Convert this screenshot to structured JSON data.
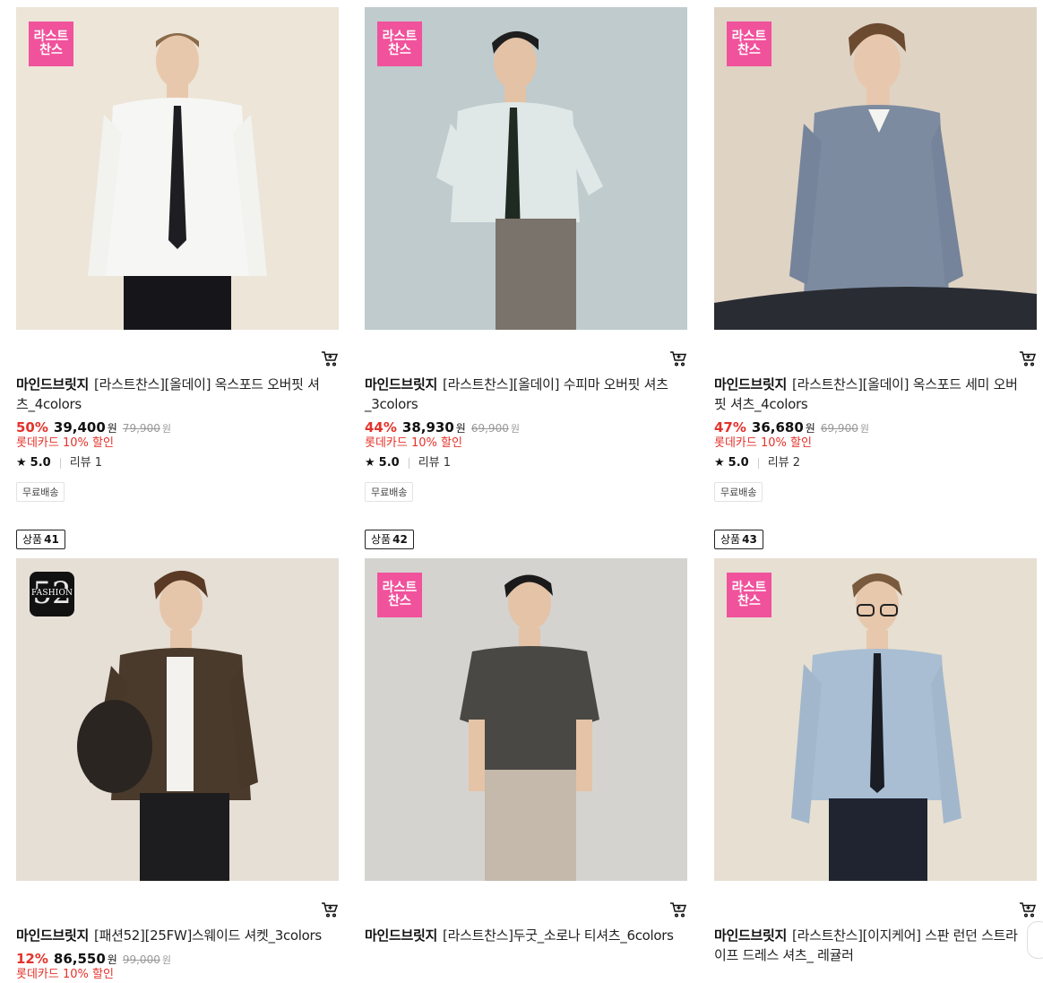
{
  "products": [
    {
      "badge": "last_chance",
      "brand": "마인드브릿지",
      "name": "[라스트찬스][올데이] 옥스포드 오버핏 셔츠_4colors",
      "discount_rate": "50%",
      "price": "39,400",
      "original_price": "79,900",
      "currency": "원",
      "card_discount": "롯데카드 10% 할인",
      "rating": "5.0",
      "review": "리뷰 1",
      "shipping": "무료배송",
      "bg_color": "#ece5d8"
    },
    {
      "badge": "last_chance",
      "brand": "마인드브릿지",
      "name": "[라스트찬스][올데이] 수피마 오버핏 셔츠_3colors",
      "discount_rate": "44%",
      "price": "38,930",
      "original_price": "69,900",
      "currency": "원",
      "card_discount": "롯데카드 10% 할인",
      "rating": "5.0",
      "review": "리뷰 1",
      "shipping": "무료배송",
      "bg_color": "#bfcbcd"
    },
    {
      "badge": "last_chance",
      "brand": "마인드브릿지",
      "name": "[라스트찬스][올데이] 옥스포드 세미 오버핏 셔츠_4colors",
      "discount_rate": "47%",
      "price": "36,680",
      "original_price": "69,900",
      "currency": "원",
      "card_discount": "롯데카드 10% 할인",
      "rating": "5.0",
      "review": "리뷰 2",
      "shipping": "무료배송",
      "bg_color": "#dfd3c4"
    },
    {
      "badge": "fashion52",
      "label": "상품",
      "label_num": "41",
      "brand": "마인드브릿지",
      "name": "[패션52][25FW]스웨이드 셔켓_3colors",
      "discount_rate": "12%",
      "price": "86,550",
      "original_price": "99,000",
      "currency": "원",
      "card_discount": "롯데카드 10% 할인",
      "bg_color": "#e6dfd6"
    },
    {
      "badge": "last_chance",
      "label": "상품",
      "label_num": "42",
      "brand": "마인드브릿지",
      "name": "[라스트찬스]두굿_소로나 티셔츠_6colors",
      "bg_color": "#d5d3d0"
    },
    {
      "badge": "last_chance",
      "label": "상품",
      "label_num": "43",
      "brand": "마인드브릿지",
      "name": "[라스트찬스][이지케어] 스판 런던 스트라이프 드레스 셔츠_ 레귤러",
      "bg_color": "#e6dfd2"
    }
  ],
  "last_chance_badge": {
    "line1": "라스트",
    "line2": "찬스"
  },
  "fashion_badge": {
    "number": "52",
    "text": "FASHION"
  },
  "colors": {
    "accent_red": "#e4322a",
    "badge_pink": "#f0529c"
  },
  "icons": {
    "cart": "cart-icon",
    "star": "star-icon"
  }
}
